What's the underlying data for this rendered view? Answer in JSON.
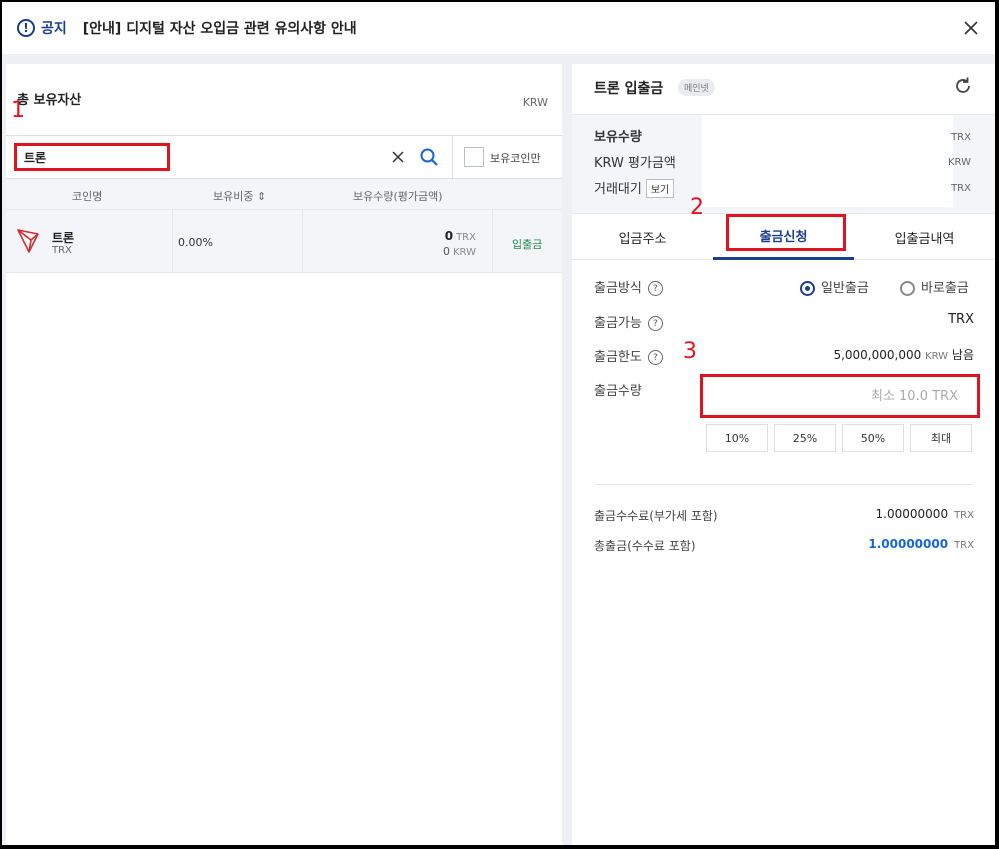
{
  "notice": {
    "label": "공지",
    "text": "[안내] 디지털 자산 오입금 관련 유의사항 안내"
  },
  "left": {
    "total_title": "총 보유자산",
    "total_unit": "KRW",
    "search_value": "트론",
    "holding_only_label": "보유코인만",
    "columns": [
      "코인명",
      "보유비중 ⇕",
      "보유수량(평가금액)"
    ],
    "rows": [
      {
        "name": "트론",
        "symbol": "TRX",
        "ratio": "0.00%",
        "amount": "0",
        "amount_unit": "TRX",
        "krw": "0",
        "krw_unit": "KRW",
        "action": "입출금"
      }
    ]
  },
  "markers": {
    "m1": "1",
    "m2": "2",
    "m3": "3"
  },
  "right": {
    "title": "트론 입출금",
    "badge": "메인넷",
    "info": {
      "holding_label": "보유수량",
      "holding_unit": "TRX",
      "krw_label": "KRW 평가금액",
      "krw_unit": "KRW",
      "pending_label": "거래대기",
      "pending_view": "보기",
      "pending_unit": "TRX"
    },
    "tabs": [
      "입금주소",
      "출금신청",
      "입출금내역"
    ],
    "form": {
      "method_label": "출금방식",
      "method_options": [
        "일반출금",
        "바로출금"
      ],
      "available_label": "출금가능",
      "available_value": "TRX",
      "limit_label": "출금한도",
      "limit_value": "5,000,000,000",
      "limit_unit": "KRW",
      "limit_suffix": "남음",
      "qty_label": "출금수량",
      "qty_placeholder": "최소 10.0 TRX",
      "pct_buttons": [
        "10%",
        "25%",
        "50%",
        "최대"
      ]
    },
    "fees": {
      "fee_label": "출금수수료(부가세 포함)",
      "fee_value": "1.00000000",
      "fee_unit": "TRX",
      "total_label": "총출금(수수료 포함)",
      "total_value": "1.00000000",
      "total_unit": "TRX"
    }
  },
  "colors": {
    "accent": "#1a3e8c",
    "highlight": "#e0141e",
    "green": "#1e8a4a",
    "blue": "#1565d8"
  }
}
